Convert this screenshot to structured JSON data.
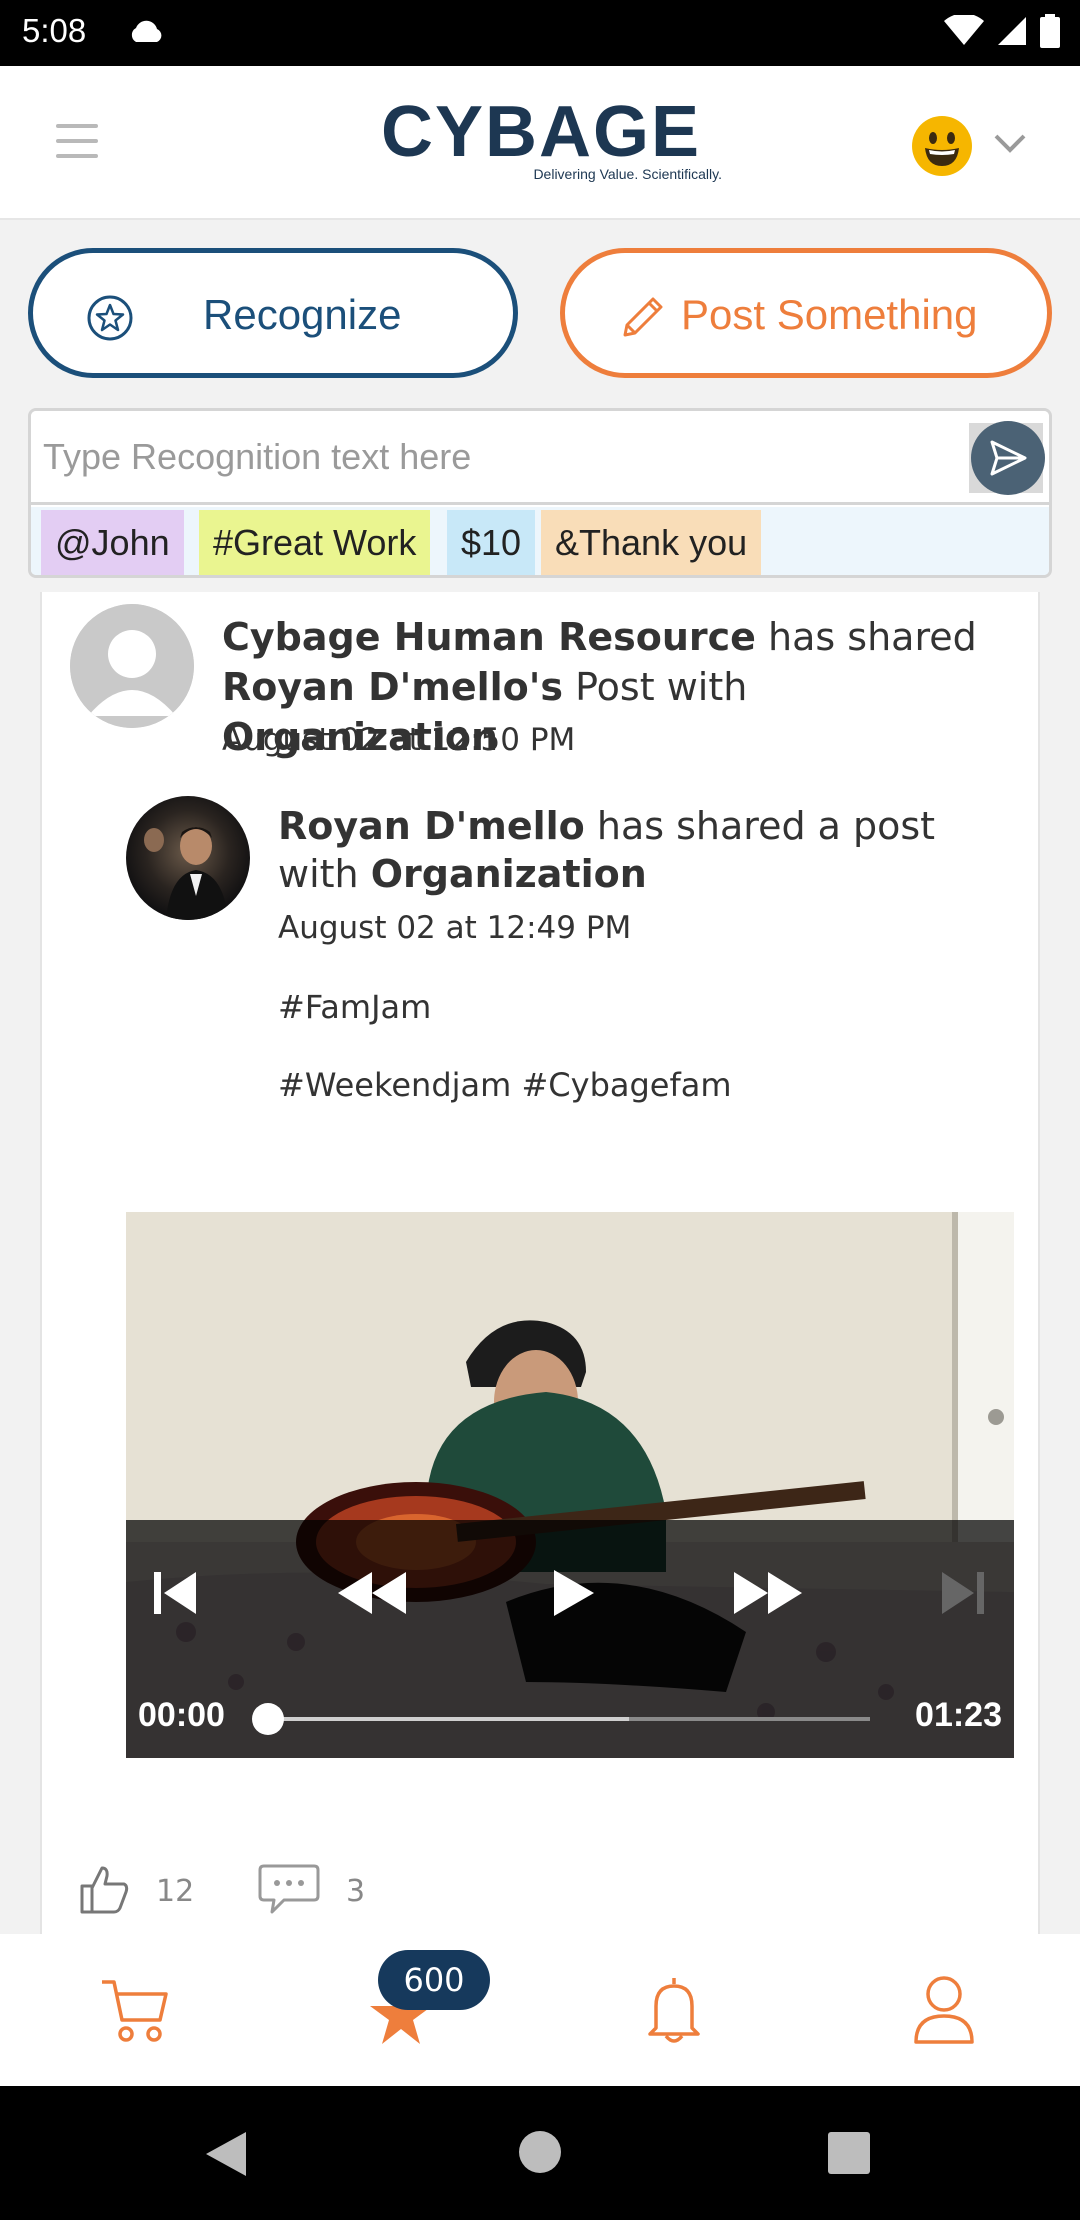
{
  "status_bar": {
    "time": "5:08"
  },
  "header": {
    "logo_text": "CYBAGE",
    "logo_tagline": "Delivering Value. Scientifically."
  },
  "actions": {
    "recognize_label": "Recognize",
    "post_label": "Post Something"
  },
  "recognition": {
    "placeholder": "Type Recognition text here",
    "chips": [
      {
        "label": "@John",
        "color": "#e3cdf3"
      },
      {
        "label": "#Great Work",
        "color": "#eaf590"
      },
      {
        "label": "$10",
        "color": "#c8e8f8"
      },
      {
        "label": "&Thank you",
        "color": "#f9ddb8"
      }
    ]
  },
  "post": {
    "sharer": "Cybage Human Resource",
    "shared_phrase": "has shared",
    "original_author_possessive": "Royan D'mello's",
    "post_with": "Post with",
    "audience": "Organization",
    "date": "August 02 at 12:50 PM",
    "inner": {
      "author": "Royan D'mello",
      "phrase": "has shared a post with",
      "audience": "Organization",
      "date": "August 02 at 12:49 PM",
      "tags_line_1": "#FamJam",
      "tags_line_2": "#Weekendjam #Cybagefam"
    },
    "video": {
      "current_time": "00:00",
      "total_time": "01:23",
      "buffered_fraction": 0.6
    },
    "likes": "12",
    "comments": "3"
  },
  "bottom_nav": {
    "points_badge": "600",
    "accent": "#ee7e3c"
  }
}
